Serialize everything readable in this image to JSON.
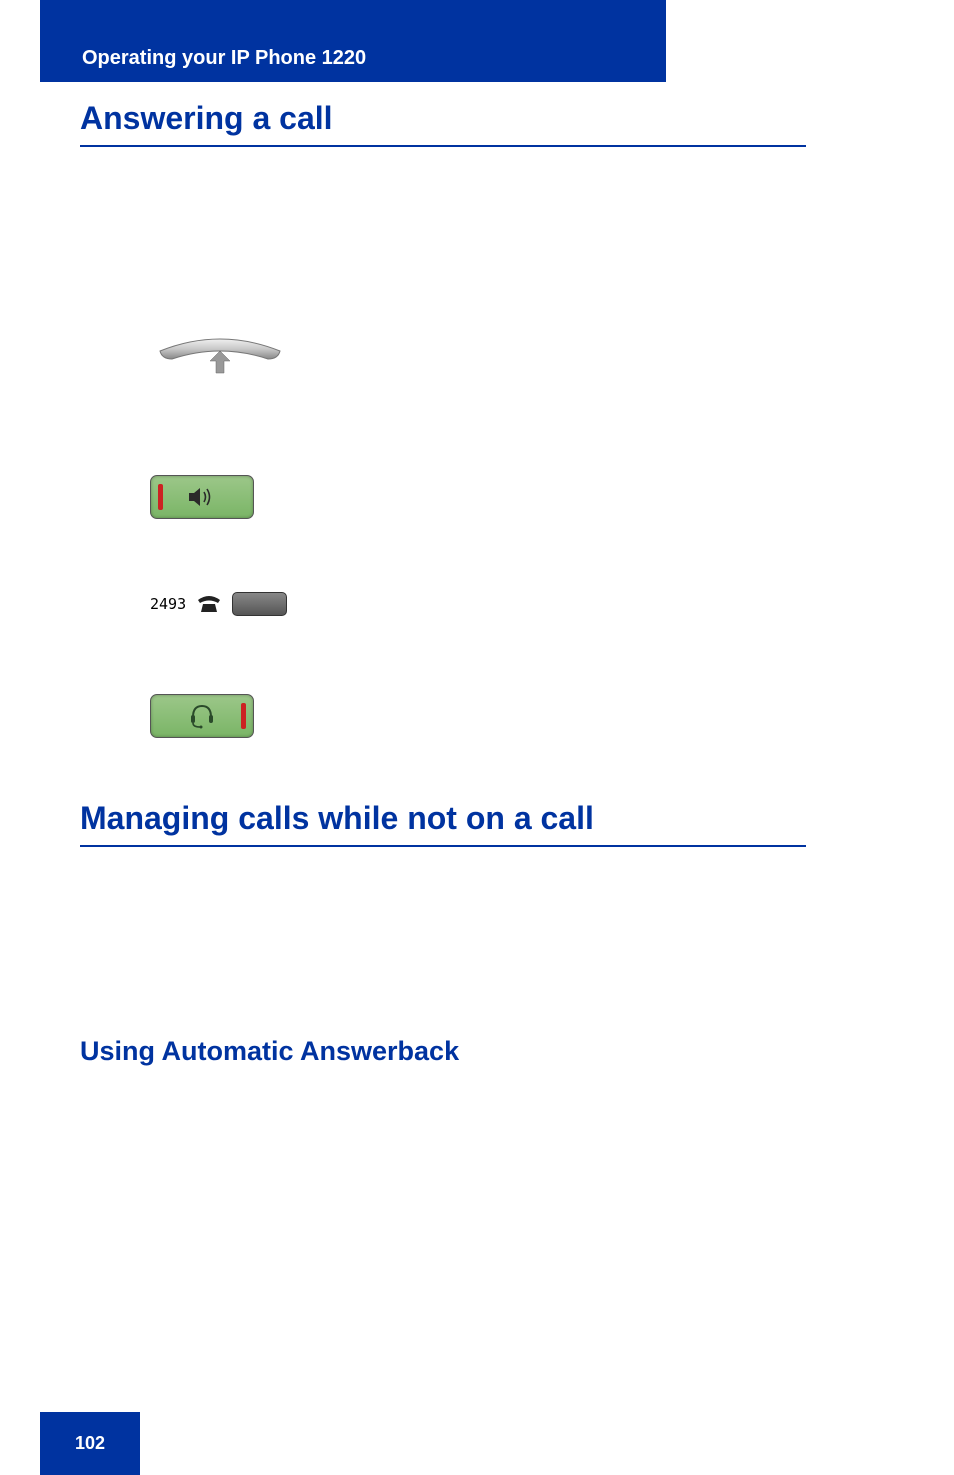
{
  "header": {
    "section": "Operating your IP Phone 1220"
  },
  "headings": {
    "h1": "Answering a call",
    "h2": "Managing calls while not on a call",
    "h3": "Using Automatic Answerback"
  },
  "line_key": {
    "number": "2493"
  },
  "icons": {
    "handset_lift": "handset-lift-icon",
    "speaker": "speaker-icon",
    "phone_small": "phone-small-icon",
    "headset": "headset-icon"
  },
  "page_number": "102"
}
